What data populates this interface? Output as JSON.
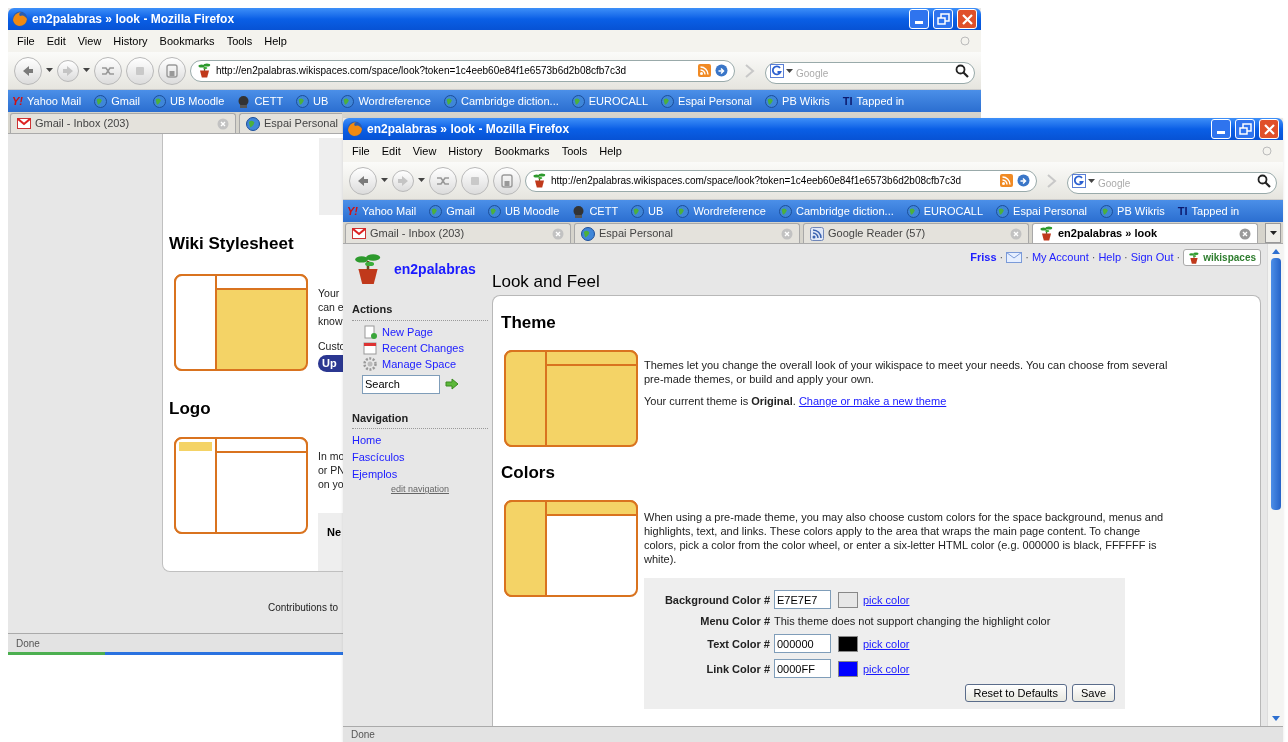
{
  "back_window": {
    "title": "en2palabras » look - Mozilla Firefox",
    "menu": [
      "File",
      "Edit",
      "View",
      "History",
      "Bookmarks",
      "Tools",
      "Help"
    ],
    "url": "http://en2palabras.wikispaces.com/space/look?token=1c4eeb60e84f1e6573b6d2b08cfb7c3d",
    "search_placeholder": "Google",
    "bookmarks": [
      {
        "label": "Yahoo Mail",
        "kind": "text",
        "icon_text": "Y!"
      },
      {
        "label": "Gmail",
        "kind": "globe"
      },
      {
        "label": "UB Moodle",
        "kind": "globe"
      },
      {
        "label": "CETT",
        "kind": "emblem"
      },
      {
        "label": "UB",
        "kind": "globe"
      },
      {
        "label": "Wordreference",
        "kind": "globe"
      },
      {
        "label": "Cambridge diction...",
        "kind": "globe"
      },
      {
        "label": "EUROCALL",
        "kind": "globe"
      },
      {
        "label": "Espai Personal",
        "kind": "globe"
      },
      {
        "label": "PB Wikris",
        "kind": "globe"
      },
      {
        "label": "Tapped in",
        "kind": "text",
        "icon_text": "TI"
      }
    ],
    "tabs": [
      {
        "label": "Gmail - Inbox (203)",
        "kind": "mail",
        "selected": false
      },
      {
        "label": "Espai Personal",
        "kind": "globe",
        "selected": false
      }
    ],
    "page": {
      "sections": [
        {
          "heading": "Wiki Stylesheet",
          "kind": "stylesheet",
          "lines": [
            "Your",
            "can e",
            "know"
          ],
          "note": "Custo",
          "button": "Up"
        },
        {
          "heading": "Logo",
          "kind": "logo",
          "lines": [
            "In mo",
            "or PN",
            "on yo"
          ],
          "box": "Ne"
        }
      ],
      "footer": "Contributions to"
    },
    "status": "Done"
  },
  "front_window": {
    "title": "en2palabras » look - Mozilla Firefox",
    "menu": [
      "File",
      "Edit",
      "View",
      "History",
      "Bookmarks",
      "Tools",
      "Help"
    ],
    "url": "http://en2palabras.wikispaces.com/space/look?token=1c4eeb60e84f1e6573b6d2b08cfb7c3d",
    "search_placeholder": "Google",
    "bookmarks": [
      {
        "label": "Yahoo Mail",
        "kind": "text",
        "icon_text": "Y!"
      },
      {
        "label": "Gmail",
        "kind": "globe"
      },
      {
        "label": "UB Moodle",
        "kind": "globe"
      },
      {
        "label": "CETT",
        "kind": "emblem"
      },
      {
        "label": "UB",
        "kind": "globe"
      },
      {
        "label": "Wordreference",
        "kind": "globe"
      },
      {
        "label": "Cambridge diction...",
        "kind": "globe"
      },
      {
        "label": "EUROCALL",
        "kind": "globe"
      },
      {
        "label": "Espai Personal",
        "kind": "globe"
      },
      {
        "label": "PB Wikris",
        "kind": "globe"
      },
      {
        "label": "Tapped in",
        "kind": "text",
        "icon_text": "TI"
      }
    ],
    "tabs": [
      {
        "label": "Gmail - Inbox (203)",
        "kind": "mail",
        "selected": false
      },
      {
        "label": "Espai Personal",
        "kind": "globe",
        "selected": false
      },
      {
        "label": "Google Reader (57)",
        "kind": "feed",
        "selected": false
      },
      {
        "label": "en2palabras » look",
        "kind": "tree",
        "selected": true
      }
    ],
    "page": {
      "site_name": "en2palabras",
      "user_links": [
        {
          "label": "Friss",
          "kind": "user"
        },
        {
          "kind": "mail"
        },
        {
          "label": "My Account",
          "kind": "link"
        },
        {
          "label": "Help",
          "kind": "link"
        },
        {
          "label": "Sign Out",
          "kind": "link"
        }
      ],
      "separator": "·",
      "badge": "wikispaces",
      "actions_heading": "Actions",
      "actions": [
        {
          "label": "New Page",
          "kind": "page"
        },
        {
          "label": "Recent Changes",
          "kind": "calendar"
        },
        {
          "label": "Manage Space",
          "kind": "gear"
        }
      ],
      "search_value": "Search",
      "navigation_heading": "Navigation",
      "navigation": [
        "Home",
        "Fascículos",
        "Ejemplos"
      ],
      "edit_link": "edit navigation",
      "heading": "Look and Feel",
      "sections": [
        {
          "heading": "Theme",
          "kind": "theme",
          "paragraphs": [
            "Themes let you change the overall look of your wikispace to meet your needs. You can choose from several pre-made themes, or build and apply your own.",
            "Your current theme is **Original**."
          ],
          "link": "Change or make a new theme"
        },
        {
          "heading": "Colors",
          "kind": "colors",
          "paragraphs": [
            "When using a pre-made theme, you may also choose custom colors for the space background, menus and highlights, text, and links. These colors apply to the area that wraps the main page content. To change colors, pick a color from the color wheel, or enter a six-letter HTML color (e.g. 000000 is black, FFFFFF is white)."
          ],
          "form": {
            "rows": [
              {
                "kind": "color",
                "label": "Background Color #",
                "value": "E7E7E7",
                "color": "#e7e7e7",
                "link": "pick color"
              },
              {
                "kind": "note",
                "label": "Menu Color #",
                "note": "This theme does not support changing the highlight color"
              },
              {
                "kind": "color",
                "label": "Text Color #",
                "value": "000000",
                "color": "#000000",
                "link": "pick color"
              },
              {
                "kind": "color",
                "label": "Link Color #",
                "value": "0000FF",
                "color": "#0000ff",
                "link": "pick color"
              }
            ],
            "buttons": [
              "Reset to Defaults",
              "Save"
            ]
          }
        }
      ]
    },
    "status": "Done"
  }
}
